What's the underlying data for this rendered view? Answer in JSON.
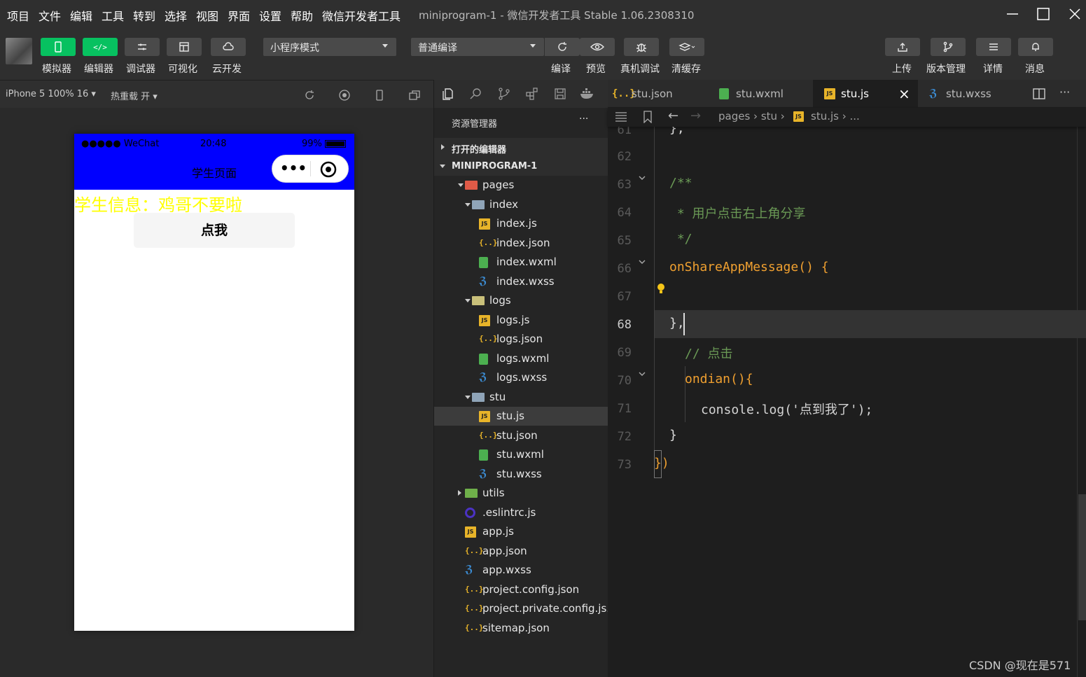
{
  "menubar": {
    "items": [
      "项目",
      "文件",
      "编辑",
      "工具",
      "转到",
      "选择",
      "视图",
      "界面",
      "设置",
      "帮助",
      "微信开发者工具"
    ],
    "title": "miniprogram-1",
    "title_sep": " - ",
    "subtitle": "微信开发者工具 Stable 1.06.2308310"
  },
  "toolbar": {
    "left_buttons": [
      {
        "label": "模拟器",
        "icon": "phone-icon"
      },
      {
        "label": "编辑器",
        "icon": "code-icon"
      },
      {
        "label": "调试器",
        "icon": "debug-icon"
      },
      {
        "label": "可视化",
        "icon": "layout-icon"
      },
      {
        "label": "云开发",
        "icon": "cloud-icon"
      }
    ],
    "mode_select": "小程序模式",
    "compile_select": "普通编译",
    "mid_buttons": [
      {
        "label": "编译",
        "icon": "refresh-icon"
      },
      {
        "label": "预览",
        "icon": "eye-icon"
      },
      {
        "label": "真机调试",
        "icon": "bug-icon"
      },
      {
        "label": "清缓存",
        "icon": "layers-icon"
      }
    ],
    "right_buttons": [
      {
        "label": "上传",
        "icon": "upload-icon"
      },
      {
        "label": "版本管理",
        "icon": "branch-icon"
      },
      {
        "label": "详情",
        "icon": "menu-icon"
      },
      {
        "label": "消息",
        "icon": "bell-icon"
      }
    ]
  },
  "simulator": {
    "device": "iPhone 5 100% 16",
    "hot_reload": "热重载 开",
    "status": {
      "carrier": "●●●●● WeChat",
      "time": "20:48",
      "battery": "99%"
    },
    "nav_title": "学生页面",
    "info_text": "学生信息：鸡哥不要啦",
    "button_label": "点我"
  },
  "explorer": {
    "title": "资源管理器",
    "more": "···",
    "open_editors": "打开的编辑器",
    "project": "MINIPROGRAM-1",
    "tree": [
      {
        "label": "pages",
        "type": "folder-open",
        "depth": 1,
        "arrow": "down"
      },
      {
        "label": "index",
        "type": "folder-open",
        "depth": 2,
        "arrow": "down"
      },
      {
        "label": "index.js",
        "type": "js",
        "depth": 3
      },
      {
        "label": "index.json",
        "type": "json",
        "depth": 3
      },
      {
        "label": "index.wxml",
        "type": "wxml",
        "depth": 3
      },
      {
        "label": "index.wxss",
        "type": "wxss",
        "depth": 3
      },
      {
        "label": "logs",
        "type": "folder-open",
        "depth": 2,
        "arrow": "down"
      },
      {
        "label": "logs.js",
        "type": "js",
        "depth": 3
      },
      {
        "label": "logs.json",
        "type": "json",
        "depth": 3
      },
      {
        "label": "logs.wxml",
        "type": "wxml",
        "depth": 3
      },
      {
        "label": "logs.wxss",
        "type": "wxss",
        "depth": 3
      },
      {
        "label": "stu",
        "type": "folder-open",
        "depth": 2,
        "arrow": "down"
      },
      {
        "label": "stu.js",
        "type": "js",
        "depth": 3,
        "selected": true
      },
      {
        "label": "stu.json",
        "type": "json",
        "depth": 3
      },
      {
        "label": "stu.wxml",
        "type": "wxml",
        "depth": 3
      },
      {
        "label": "stu.wxss",
        "type": "wxss",
        "depth": 3
      },
      {
        "label": "utils",
        "type": "folder",
        "depth": 1,
        "arrow": "right"
      },
      {
        "label": ".eslintrc.js",
        "type": "eslint",
        "depth": 1
      },
      {
        "label": "app.js",
        "type": "js",
        "depth": 1
      },
      {
        "label": "app.json",
        "type": "json",
        "depth": 1
      },
      {
        "label": "app.wxss",
        "type": "wxss",
        "depth": 1
      },
      {
        "label": "project.config.json",
        "type": "json",
        "depth": 1
      },
      {
        "label": "project.private.config.js...",
        "type": "json",
        "depth": 1
      },
      {
        "label": "sitemap.json",
        "type": "json",
        "depth": 1
      }
    ]
  },
  "editor": {
    "tabs": [
      {
        "label": "stu.json",
        "type": "json"
      },
      {
        "label": "stu.wxml",
        "type": "wxml"
      },
      {
        "label": "stu.js",
        "type": "js",
        "active": true
      },
      {
        "label": "stu.wxss",
        "type": "wxss"
      }
    ],
    "close": "×",
    "breadcrumb": {
      "path1": "pages",
      "path2": "stu",
      "file": "stu.js",
      "more": "..."
    },
    "lines": [
      {
        "n": "61",
        "text": "},"
      },
      {
        "n": "62",
        "text": ""
      },
      {
        "n": "63",
        "text": "/**"
      },
      {
        "n": "64",
        "text": " * 用户点击右上角分享"
      },
      {
        "n": "65",
        "text": " */"
      },
      {
        "n": "66",
        "text": "onShareAppMessage() {"
      },
      {
        "n": "67",
        "text": ""
      },
      {
        "n": "68",
        "text": "},"
      },
      {
        "n": "69",
        "text": "// 点击"
      },
      {
        "n": "70",
        "text": "ondian(){"
      },
      {
        "n": "71",
        "text": "console.log('点到我了');"
      },
      {
        "n": "72",
        "text": "}"
      },
      {
        "n": "73",
        "text": "})"
      }
    ]
  },
  "watermark": "CSDN @现在是571"
}
